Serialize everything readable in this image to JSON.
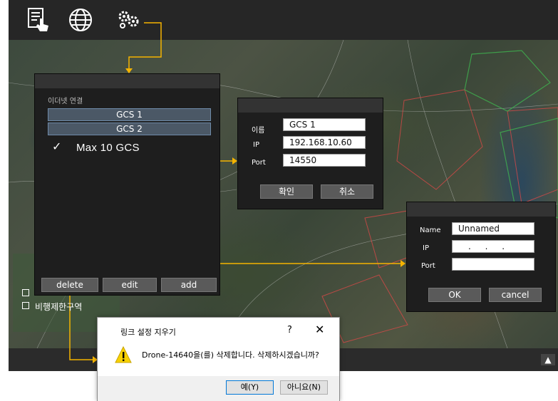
{
  "toolbar": {
    "icons": [
      "document-touch-icon",
      "globe-icon",
      "gears-icon"
    ]
  },
  "gcs_panel": {
    "title": "이더넷 연결",
    "items": [
      "GCS 1",
      "GCS 2"
    ],
    "check": "✓",
    "max_text": "Max 10 GCS",
    "buttons": {
      "delete": "delete",
      "edit": "edit",
      "add": "add"
    }
  },
  "edit_dialog": {
    "name_label": "이름",
    "name_value": "GCS 1",
    "ip_label": "IP",
    "ip_value": "192.168.10.60",
    "port_label": "Port",
    "port_value": "14550",
    "ok_label": "확인",
    "cancel_label": "취소"
  },
  "add_dialog": {
    "name_label": "Name",
    "name_value": "Unnamed",
    "ip_label": "IP",
    "ip_value": ". . .",
    "port_label": "Port",
    "port_value": "",
    "ok_label": "OK",
    "cancel_label": "cancel"
  },
  "legend": {
    "item2": "비행제한구역"
  },
  "confirm_dialog": {
    "title": "링크 설정 지우기",
    "help": "?",
    "close": "✕",
    "message": "Drone-14640을(를) 삭제합니다. 삭제하시겠습니까?",
    "yes_label": "예(Y)",
    "no_label": "아니요(N)"
  },
  "statusbar": {
    "expand": "▲"
  },
  "colors": {
    "connector": "#f5b400",
    "panel": "#1e1e1e",
    "list_item": "#4b5866",
    "toolbar": "#262626"
  }
}
